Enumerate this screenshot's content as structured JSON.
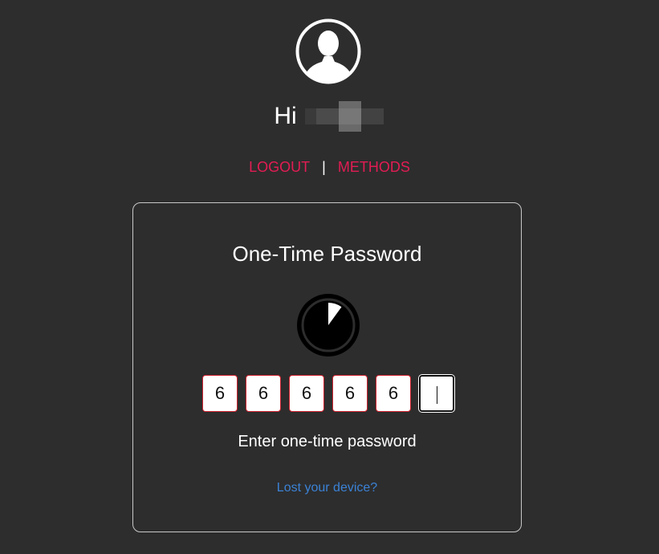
{
  "user": {
    "greeting": "Hi",
    "avatar_icon": "user-silhouette-icon"
  },
  "nav": {
    "logout_label": "LOGOUT",
    "separator": "|",
    "methods_label": "METHODS"
  },
  "card": {
    "title": "One-Time Password",
    "timer_icon": "countdown-timer-icon",
    "timer_remaining_fraction": 0.9,
    "otp_digits": [
      "6",
      "6",
      "6",
      "6",
      "6",
      ""
    ],
    "hint": "Enter one-time password",
    "lost_device_link": "Lost your device?"
  },
  "colors": {
    "background": "#2d2d2d",
    "accent": "#e21c53",
    "link": "#3b82d6",
    "otp_border": "#d0222f"
  }
}
